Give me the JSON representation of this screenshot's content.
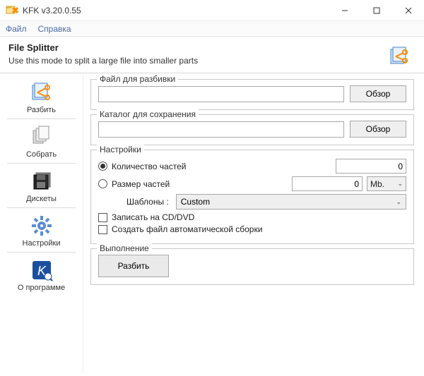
{
  "window": {
    "title": "KFK v3.20.0.55"
  },
  "menu": {
    "file": "Файл",
    "help": "Справка"
  },
  "header": {
    "title": "File Splitter",
    "subtitle": "Use this mode to split a large file into smaller parts"
  },
  "sidebar": {
    "items": [
      {
        "label": "Разбить"
      },
      {
        "label": "Собрать"
      },
      {
        "label": "Дискеты"
      },
      {
        "label": "Настройки"
      },
      {
        "label": "О программе"
      }
    ]
  },
  "main": {
    "file_group": {
      "label": "Файл для разбивки",
      "value": "",
      "browse": "Обзор"
    },
    "dest_group": {
      "label": "Каталог для сохранения",
      "value": "",
      "browse": "Обзор"
    },
    "settings": {
      "label": "Настройки",
      "parts_count_label": "Количество частей",
      "parts_count_value": "0",
      "parts_size_label": "Размер частей",
      "parts_size_value": "0",
      "parts_size_unit": "Mb.",
      "templates_label": "Шаблоны :",
      "templates_value": "Custom",
      "cd_dvd": "Записать на CD/DVD",
      "auto_assembly": "Создать файл автоматической сборки"
    },
    "run": {
      "label": "Выполнение",
      "button": "Разбить"
    }
  }
}
